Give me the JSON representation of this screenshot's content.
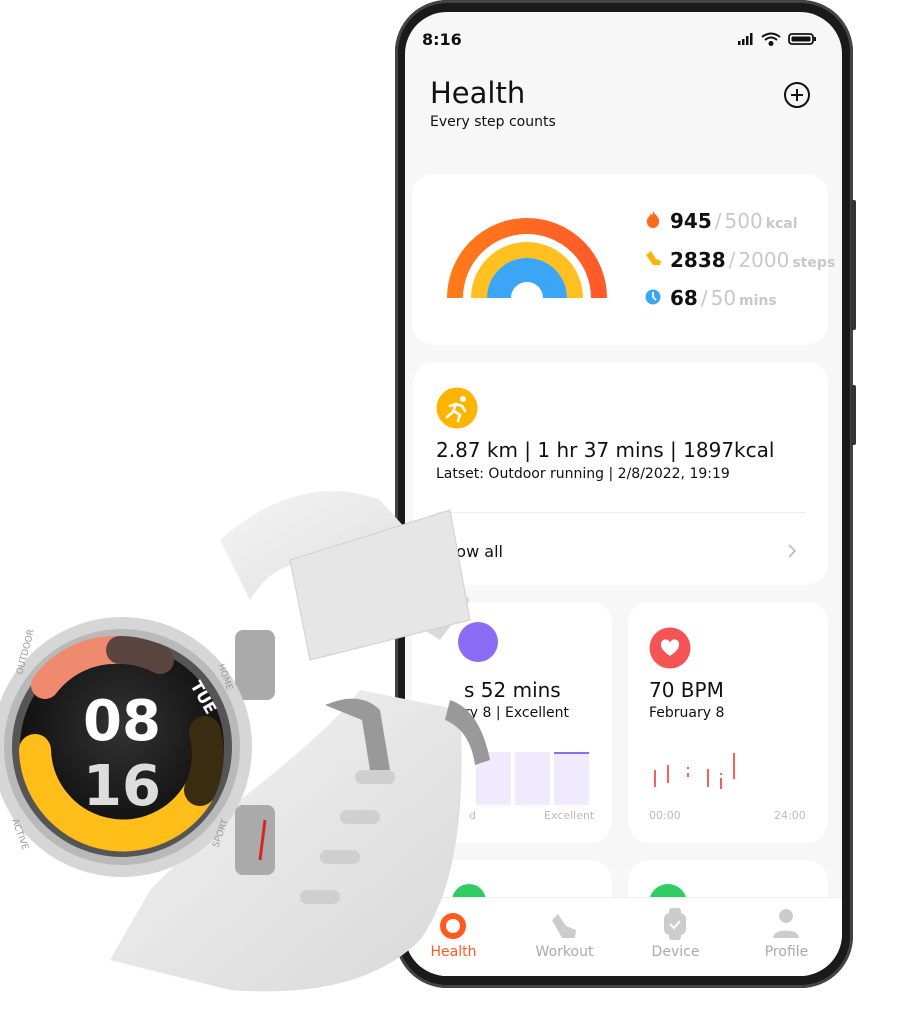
{
  "status_bar": {
    "time": "8:16"
  },
  "header": {
    "title": "Health",
    "subtitle": "Every step counts",
    "add_icon": "plus-circle-icon"
  },
  "activity": {
    "stats": [
      {
        "icon": "flame-icon",
        "color": "#ff6a1a",
        "value": "945",
        "goal": "500",
        "unit": "kcal"
      },
      {
        "icon": "shoe-icon",
        "color": "#ffb400",
        "value": "2838",
        "goal": "2000",
        "unit": "steps"
      },
      {
        "icon": "clock-icon",
        "color": "#3aa6f5",
        "value": "68",
        "goal": "50",
        "unit": "mins"
      }
    ]
  },
  "workout": {
    "icon": "running-icon",
    "summary": "2.87 km | 1 hr 37 mins | 1897kcal",
    "latest": "Latset:  Outdoor running | 2/8/2022, 19:19",
    "show_all": "Show all"
  },
  "sleep": {
    "value": "s 52 mins",
    "sub": "ry 8 | Excellent",
    "axis_left": "d",
    "axis_right": "Excellent"
  },
  "heart": {
    "icon": "heart-icon",
    "value": "70 BPM",
    "date": "February 8",
    "axis_start": "00:00",
    "axis_end": "24:00"
  },
  "tabs": [
    {
      "label": "Health",
      "icon": "ring-icon",
      "active": true
    },
    {
      "label": "Workout",
      "icon": "shoe-icon",
      "active": false
    },
    {
      "label": "Device",
      "icon": "watch-icon",
      "active": false
    },
    {
      "label": "Profile",
      "icon": "person-icon",
      "active": false
    }
  ],
  "watch": {
    "day": "TUE",
    "hour": "08",
    "minute": "16",
    "bezel": [
      "OUTDOOR",
      "HOME",
      "SPORT",
      "ACTIVE"
    ]
  },
  "colors": {
    "accent": "#ff5a1f",
    "heart": "#f45454",
    "sleep": "#8a6cf5"
  }
}
